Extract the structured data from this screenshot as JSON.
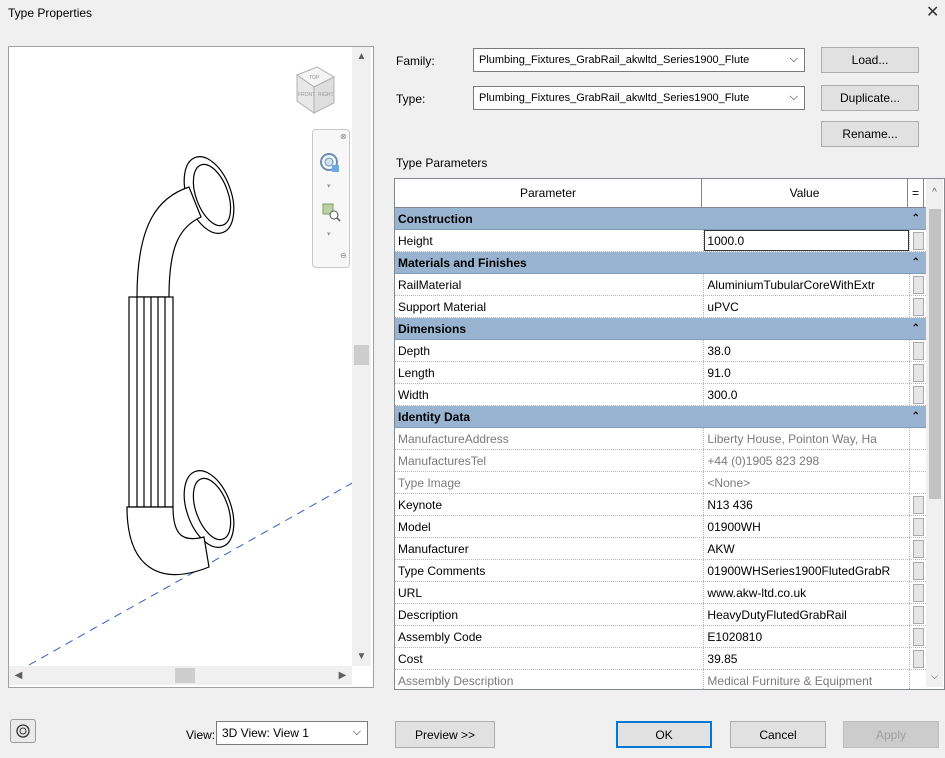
{
  "window": {
    "title": "Type Properties",
    "close_glyph": "✕"
  },
  "preview": {
    "view_label": "View:",
    "view_value": "3D View: View 1",
    "viewcube_labels": {
      "top": "TOP",
      "front": "FRONT",
      "right": "RIGHT"
    }
  },
  "family": {
    "label": "Family:",
    "value": "Plumbing_Fixtures_GrabRail_akwltd_Series1900_Flute"
  },
  "type": {
    "label": "Type:",
    "value": "Plumbing_Fixtures_GrabRail_akwltd_Series1900_Flute"
  },
  "buttons": {
    "load": "Load...",
    "duplicate": "Duplicate...",
    "rename": "Rename...",
    "preview": "Preview >>",
    "ok": "OK",
    "cancel": "Cancel",
    "apply": "Apply"
  },
  "type_parameters": {
    "label": "Type Parameters",
    "col_parameter": "Parameter",
    "col_value": "Value",
    "col_eq": "=",
    "collapse_glyph": "»"
  },
  "sections": [
    {
      "name": "Construction",
      "rows": [
        {
          "param": "Height",
          "value": "1000.0",
          "dim": false,
          "active": true
        }
      ]
    },
    {
      "name": "Materials and Finishes",
      "rows": [
        {
          "param": "RailMaterial",
          "value": "AluminiumTubularCoreWithExtr",
          "dim": false
        },
        {
          "param": "Support Material",
          "value": "uPVC",
          "dim": false
        }
      ]
    },
    {
      "name": "Dimensions",
      "rows": [
        {
          "param": "Depth",
          "value": "38.0",
          "dim": false
        },
        {
          "param": "Length",
          "value": "91.0",
          "dim": false
        },
        {
          "param": "Width",
          "value": "300.0",
          "dim": false
        }
      ]
    },
    {
      "name": "Identity Data",
      "rows": [
        {
          "param": "ManufactureAddress",
          "value": "Liberty House, Pointon Way, Ha",
          "dim": true
        },
        {
          "param": "ManufacturesTel",
          "value": "+44 (0)1905 823 298",
          "dim": true
        },
        {
          "param": "Type Image",
          "value": "<None>",
          "dim": true
        },
        {
          "param": "Keynote",
          "value": "N13 436",
          "dim": false
        },
        {
          "param": "Model",
          "value": "01900WH",
          "dim": false
        },
        {
          "param": "Manufacturer",
          "value": "AKW",
          "dim": false
        },
        {
          "param": "Type Comments",
          "value": "01900WHSeries1900FlutedGrabR",
          "dim": false
        },
        {
          "param": "URL",
          "value": "www.akw-ltd.co.uk",
          "dim": false
        },
        {
          "param": "Description",
          "value": "HeavyDutyFlutedGrabRail",
          "dim": false
        },
        {
          "param": "Assembly Code",
          "value": "E1020810",
          "dim": false
        },
        {
          "param": "Cost",
          "value": "39.85",
          "dim": false
        },
        {
          "param": "Assembly Description",
          "value": "Medical Furniture & Equipment",
          "dim": true
        }
      ]
    }
  ]
}
